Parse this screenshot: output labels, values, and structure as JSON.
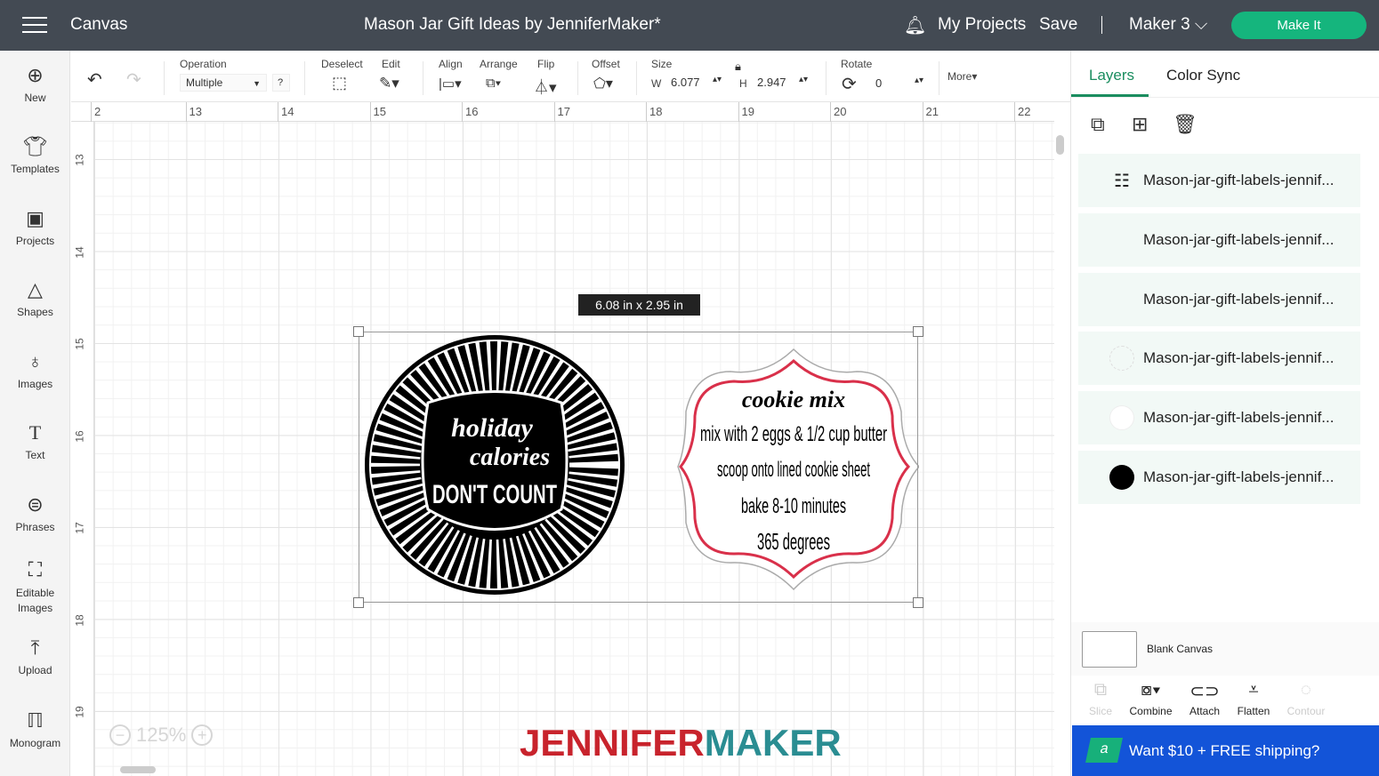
{
  "topbar": {
    "menu_icon": "hamburger-icon",
    "section": "Canvas",
    "title": "Mason Jar Gift Ideas by JenniferMaker*",
    "notifications_icon": "bell-icon",
    "my_projects": "My Projects",
    "save": "Save",
    "separator": "|",
    "machine": "Maker 3",
    "make_it": "Make It"
  },
  "sidebar": [
    {
      "label": "New",
      "icon": "plus-circle-icon"
    },
    {
      "label": "Templates",
      "icon": "shirt-icon"
    },
    {
      "label": "Projects",
      "icon": "projects-icon"
    },
    {
      "label": "Shapes",
      "icon": "shapes-icon"
    },
    {
      "label": "Images",
      "icon": "lightbulb-icon"
    },
    {
      "label": "Text",
      "icon": "text-icon"
    },
    {
      "label": "Phrases",
      "icon": "speech-bubble-icon"
    },
    {
      "label": "Editable Images",
      "icon": "editable-image-icon"
    },
    {
      "label": "Upload",
      "icon": "upload-icon"
    },
    {
      "label": "Monogram",
      "icon": "monogram-icon"
    }
  ],
  "toolbar": {
    "operation_label": "Operation",
    "operation_value": "Multiple",
    "help": "?",
    "deselect": "Deselect",
    "edit": "Edit",
    "align": "Align",
    "arrange": "Arrange",
    "flip": "Flip",
    "offset": "Offset",
    "size": "Size",
    "w_label": "W",
    "w_value": "6.077",
    "h_label": "H",
    "h_value": "2.947",
    "rotate": "Rotate",
    "rotate_value": "0",
    "more": "More"
  },
  "ruler": {
    "horizontal": [
      "2",
      "13",
      "14",
      "15",
      "16",
      "17",
      "18",
      "19",
      "20",
      "21",
      "22"
    ],
    "vertical": [
      "13",
      "14",
      "15",
      "16",
      "17",
      "18",
      "19"
    ]
  },
  "canvas": {
    "size_tooltip": "6.08  in x 2.95  in",
    "zoom": "125%",
    "logo_left": "JENNIFER",
    "logo_right": "MAKER",
    "logo_colors": {
      "left": "#c8232c",
      "right": "#2a8d92"
    },
    "circle_label": {
      "line1": "holiday",
      "line2": "calories",
      "line3": "DON'T COUNT"
    },
    "cookie_label": {
      "title": "cookie mix",
      "lines": [
        "mix with 2 eggs & 1/2 cup butter",
        "scoop onto lined cookie sheet",
        "bake 8-10 minutes",
        "365 degrees"
      ],
      "border_color": "#d9304a"
    }
  },
  "panel": {
    "tabs": [
      "Layers",
      "Color Sync"
    ],
    "active_tab": "Layers",
    "accent": "#1a8d5f",
    "layers": [
      {
        "name": "Mason-jar-gift-labels-jennif...",
        "swatch": "pattern"
      },
      {
        "name": "Mason-jar-gift-labels-jennif...",
        "swatch": "none"
      },
      {
        "name": "Mason-jar-gift-labels-jennif...",
        "swatch": "none"
      },
      {
        "name": "Mason-jar-gift-labels-jennif...",
        "swatch": "outline"
      },
      {
        "name": "Mason-jar-gift-labels-jennif...",
        "swatch": "white"
      },
      {
        "name": "Mason-jar-gift-labels-jennif...",
        "swatch": "#000000"
      }
    ],
    "blank_canvas": "Blank Canvas",
    "actions": [
      {
        "label": "Slice",
        "enabled": false
      },
      {
        "label": "Combine",
        "enabled": true
      },
      {
        "label": "Attach",
        "enabled": true
      },
      {
        "label": "Flatten",
        "enabled": true
      },
      {
        "label": "Contour",
        "enabled": false
      }
    ],
    "promo": "Want $10 + FREE shipping?"
  }
}
